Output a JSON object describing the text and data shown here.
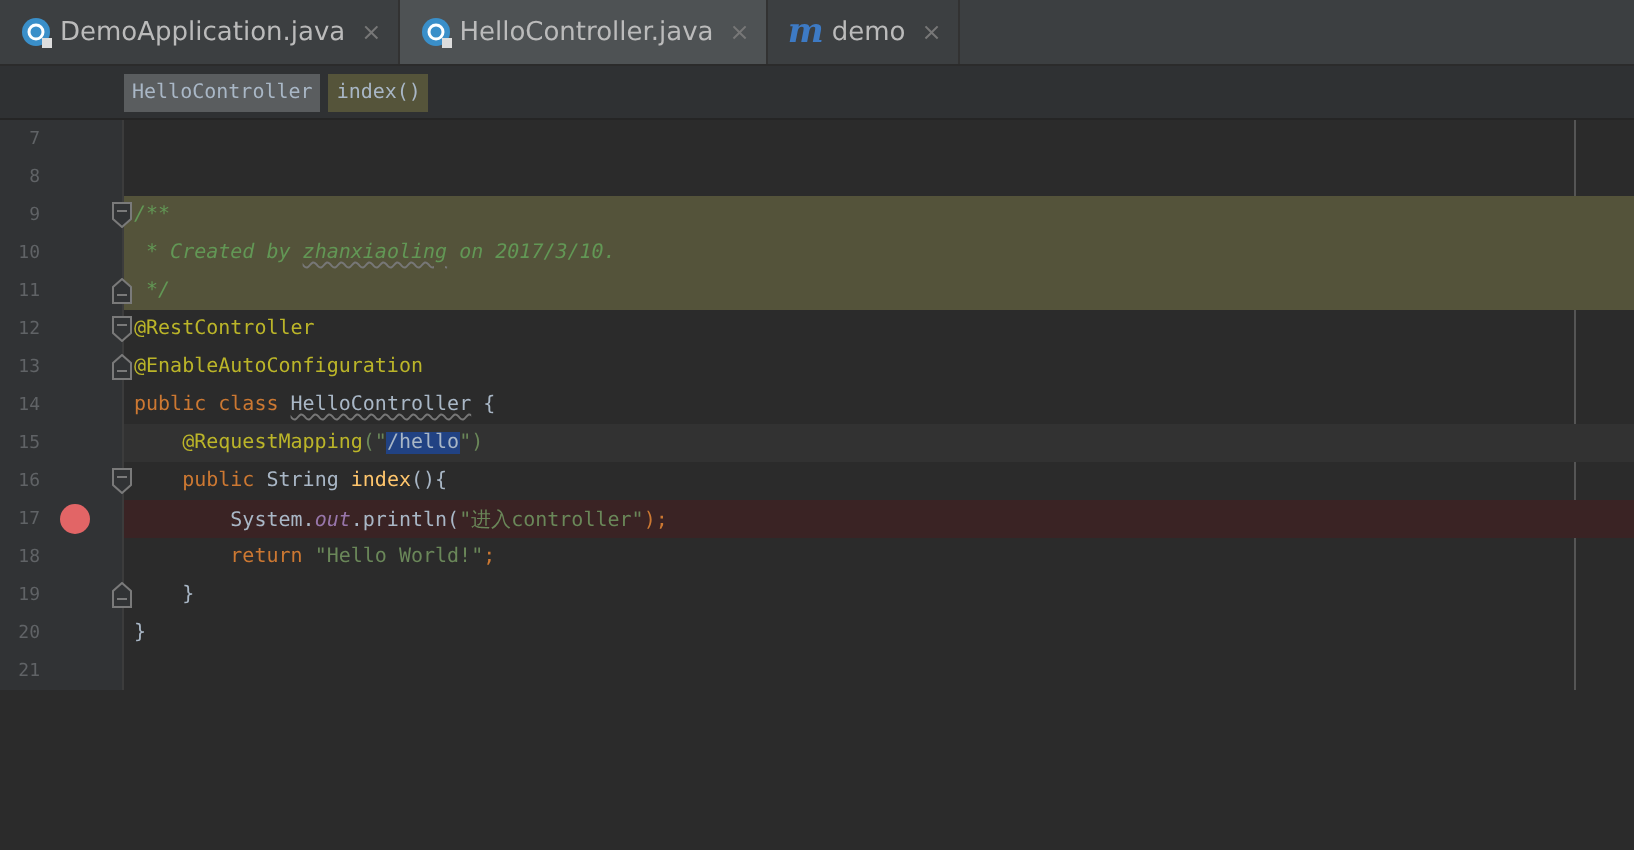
{
  "tabs": [
    {
      "label": "DemoApplication.java",
      "kind": "class",
      "close": "×",
      "selected": false
    },
    {
      "label": "HelloController.java",
      "kind": "class",
      "close": "×",
      "selected": true
    },
    {
      "label": "demo",
      "kind": "maven",
      "icon_glyph": "m",
      "close": "×",
      "selected": false
    }
  ],
  "breadcrumbs": [
    {
      "label": "HelloController",
      "kind": "class"
    },
    {
      "label": "index()",
      "kind": "method"
    }
  ],
  "lines": [
    {
      "number": "7",
      "kind": "plain",
      "breakpoint": false
    },
    {
      "number": "8",
      "kind": "plain",
      "breakpoint": false
    },
    {
      "number": "9",
      "kind": "doc",
      "fold": {
        "kind": "start"
      },
      "breakpoint": false,
      "tokens": [
        {
          "text": "/**",
          "kind": "doc"
        }
      ]
    },
    {
      "number": "10",
      "kind": "doc",
      "breakpoint": false,
      "tokens": [
        {
          "text": " * Created by ",
          "kind": "doc"
        },
        {
          "text": "zhanxiaoling",
          "kind": "doc-typo"
        },
        {
          "text": " on 2017/3/10.",
          "kind": "doc"
        }
      ]
    },
    {
      "number": "11",
      "kind": "doc",
      "fold": {
        "kind": "end"
      },
      "breakpoint": false,
      "tokens": [
        {
          "text": " */",
          "kind": "doc"
        }
      ]
    },
    {
      "number": "12",
      "kind": "plain",
      "fold": {
        "kind": "start"
      },
      "breakpoint": false,
      "tokens": [
        {
          "text": "@RestController",
          "kind": "annotation"
        }
      ]
    },
    {
      "number": "13",
      "kind": "plain",
      "fold": {
        "kind": "end"
      },
      "breakpoint": false,
      "tokens": [
        {
          "text": "@EnableAutoConfiguration",
          "kind": "annotation"
        }
      ]
    },
    {
      "number": "14",
      "kind": "plain",
      "breakpoint": false,
      "tokens": [
        {
          "text": "public class ",
          "kind": "keyword"
        },
        {
          "text": "HelloController",
          "kind": "plain-typo"
        },
        {
          "text": " {",
          "kind": "plain"
        }
      ]
    },
    {
      "number": "15",
      "kind": "caret",
      "breakpoint": false,
      "tokens": [
        {
          "text": "    @RequestMapping",
          "kind": "annotation"
        },
        {
          "text": "(\"",
          "kind": "string"
        },
        {
          "text": "/hello",
          "kind": "selection"
        },
        {
          "text": "\")",
          "kind": "string"
        }
      ]
    },
    {
      "number": "16",
      "kind": "plain",
      "fold": {
        "kind": "start"
      },
      "breakpoint": false,
      "tokens": [
        {
          "text": "    public ",
          "kind": "keyword"
        },
        {
          "text": "String ",
          "kind": "plain"
        },
        {
          "text": "index",
          "kind": "method"
        },
        {
          "text": "(){",
          "kind": "plain"
        }
      ]
    },
    {
      "number": "17",
      "kind": "breakpoint",
      "breakpoint": true,
      "tokens": [
        {
          "text": "        System.",
          "kind": "plain"
        },
        {
          "text": "out",
          "kind": "field"
        },
        {
          "text": ".println(",
          "kind": "plain"
        },
        {
          "text": "\"进入controller\"",
          "kind": "string"
        },
        {
          "text": ");",
          "kind": "keyword"
        }
      ]
    },
    {
      "number": "18",
      "kind": "plain",
      "breakpoint": false,
      "tokens": [
        {
          "text": "        return ",
          "kind": "keyword"
        },
        {
          "text": "\"Hello World!\"",
          "kind": "string"
        },
        {
          "text": ";",
          "kind": "keyword"
        }
      ]
    },
    {
      "number": "19",
      "kind": "plain",
      "fold": {
        "kind": "end"
      },
      "breakpoint": false,
      "tokens": [
        {
          "text": "    }",
          "kind": "plain"
        }
      ]
    },
    {
      "number": "20",
      "kind": "plain",
      "breakpoint": false,
      "tokens": [
        {
          "text": "}",
          "kind": "plain"
        }
      ]
    },
    {
      "number": "21",
      "kind": "plain",
      "breakpoint": false
    }
  ]
}
